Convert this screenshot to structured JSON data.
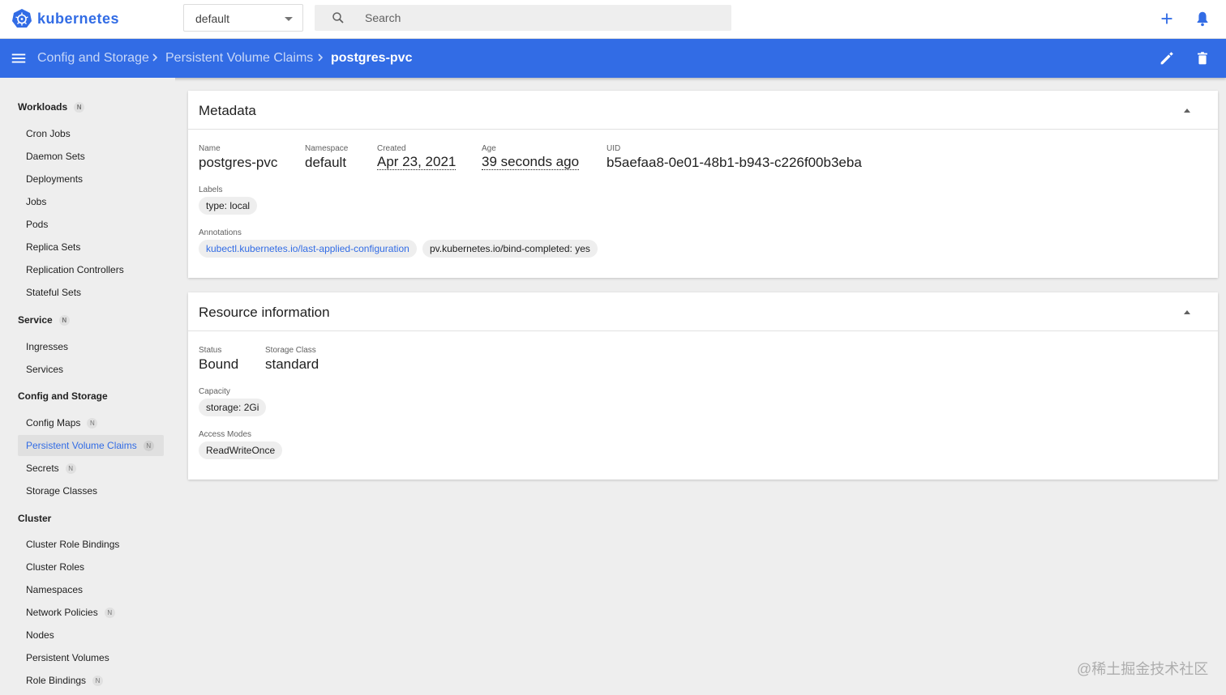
{
  "app": {
    "brand": "kubernetes",
    "namespace_value": "default",
    "search_placeholder": "Search"
  },
  "breadcrumb": {
    "items": [
      "Config and Storage",
      "Persistent Volume Claims"
    ],
    "current": "postgres-pvc"
  },
  "sidebar": {
    "badge": "N",
    "workloads": {
      "title": "Workloads",
      "items": [
        "Cron Jobs",
        "Daemon Sets",
        "Deployments",
        "Jobs",
        "Pods",
        "Replica Sets",
        "Replication Controllers",
        "Stateful Sets"
      ]
    },
    "service": {
      "title": "Service",
      "items": [
        "Ingresses",
        "Services"
      ]
    },
    "config_storage": {
      "title": "Config and Storage",
      "items": [
        "Config Maps",
        "Persistent Volume Claims",
        "Secrets",
        "Storage Classes"
      ],
      "active": "Persistent Volume Claims"
    },
    "cluster": {
      "title": "Cluster",
      "items": [
        "Cluster Role Bindings",
        "Cluster Roles",
        "Namespaces",
        "Network Policies",
        "Nodes",
        "Persistent Volumes",
        "Role Bindings"
      ]
    }
  },
  "metadata": {
    "title": "Metadata",
    "name_label": "Name",
    "name": "postgres-pvc",
    "namespace_label": "Namespace",
    "namespace": "default",
    "created_label": "Created",
    "created": "Apr 23, 2021",
    "age_label": "Age",
    "age": "39 seconds ago",
    "uid_label": "UID",
    "uid": "b5aefaa8-0e01-48b1-b943-c226f00b3eba",
    "labels_label": "Labels",
    "labels": [
      "type: local"
    ],
    "annotations_label": "Annotations",
    "annotations": [
      "kubectl.kubernetes.io/last-applied-configuration",
      "pv.kubernetes.io/bind-completed: yes"
    ]
  },
  "resource": {
    "title": "Resource information",
    "status_label": "Status",
    "status": "Bound",
    "storage_class_label": "Storage Class",
    "storage_class": "standard",
    "capacity_label": "Capacity",
    "capacity": "storage: 2Gi",
    "access_modes_label": "Access Modes",
    "access_modes": "ReadWriteOnce"
  },
  "colors": {
    "primary": "#326ce5",
    "background": "#eeeeee"
  },
  "watermark": "@稀土掘金技术社区"
}
